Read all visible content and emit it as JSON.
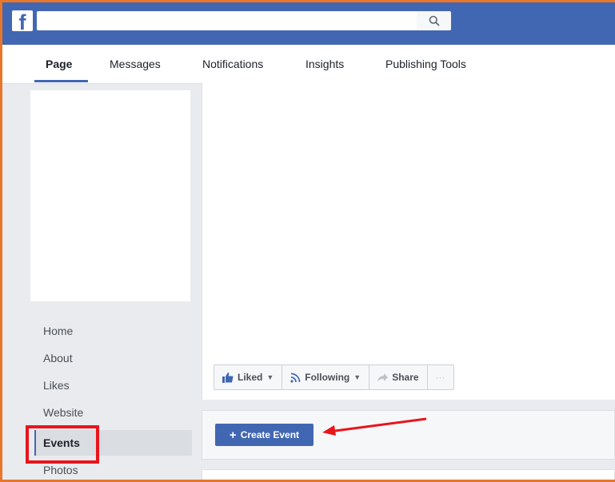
{
  "topbar": {
    "logo_letter": "f",
    "search_placeholder": "",
    "icons": [
      "facebook-logo-icon",
      "search-icon"
    ]
  },
  "tabs": [
    {
      "label": "Page",
      "active": true
    },
    {
      "label": "Messages",
      "active": false
    },
    {
      "label": "Notifications",
      "active": false
    },
    {
      "label": "Insights",
      "active": false
    },
    {
      "label": "Publishing Tools",
      "active": false
    }
  ],
  "sidebar": {
    "items": [
      {
        "label": "Home"
      },
      {
        "label": "About"
      },
      {
        "label": "Likes"
      },
      {
        "label": "Website"
      },
      {
        "label": "Events",
        "active": true
      },
      {
        "label": "Photos"
      }
    ]
  },
  "actions": {
    "liked_label": "Liked",
    "following_label": "Following",
    "share_label": "Share",
    "more_label": "···"
  },
  "events": {
    "create_label": "Create Event",
    "plus": "+"
  },
  "colors": {
    "brand_blue": "#4267b2",
    "frame_orange": "#e8762b",
    "highlight_red": "#e8151b",
    "page_bg": "#e9ebee"
  }
}
